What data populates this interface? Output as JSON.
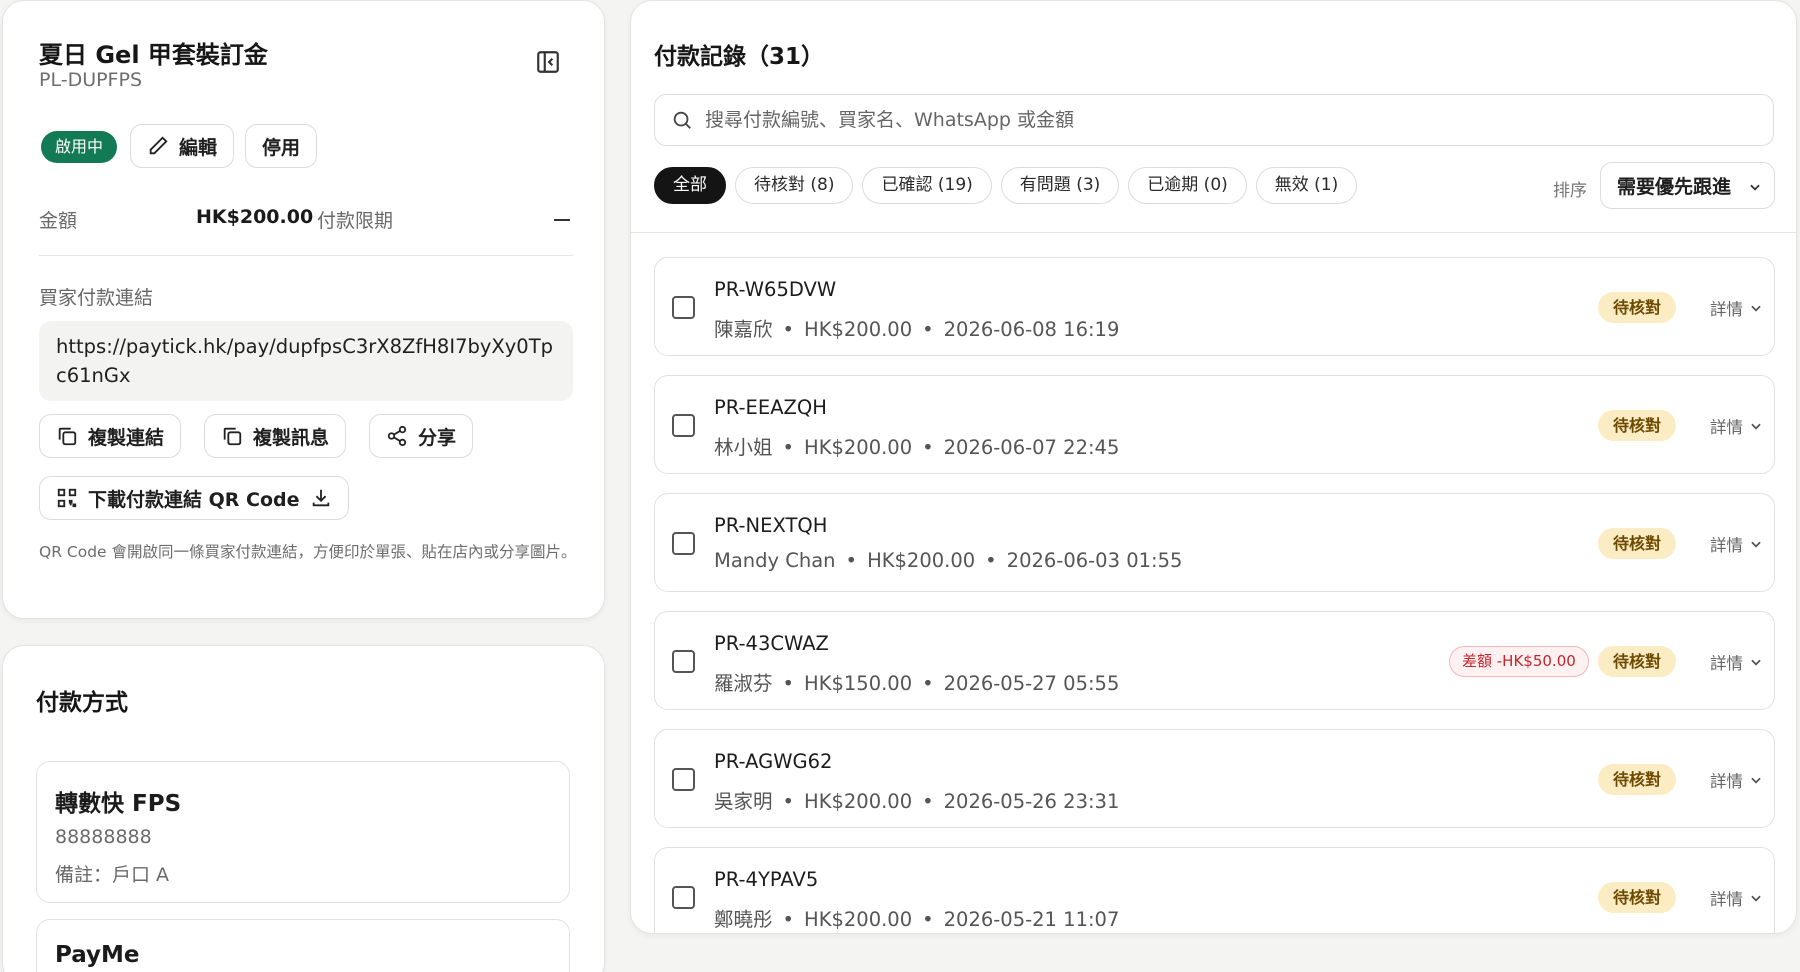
{
  "link_page": {
    "title": "夏日 Gel 甲套裝訂金",
    "code": "PL-DUPFPS",
    "status": "啟用中",
    "edit_label": "編輯",
    "disable_label": "停用",
    "amount_label": "金額",
    "amount_value": "HK$200.00",
    "deadline_label": "付款限期",
    "buyer_link_label": "買家付款連結",
    "buyer_link_url": "https://paytick.hk/pay/dupfpsC3rX8ZfH8I7byXy0Tpc61nGx",
    "copy_link_label": "複製連結",
    "copy_message_label": "複製訊息",
    "share_label": "分享",
    "qr_download_label": "下載付款連結 QR Code",
    "qr_hint": "QR Code 會開啟同一條買家付款連結，方便印於單張、貼在店內或分享圖片。"
  },
  "payment_methods": {
    "title": "付款方式",
    "items": [
      {
        "name": "轉數快 FPS",
        "account": "88888888",
        "note": "備註：戶口 A"
      },
      {
        "name": "PayMe"
      }
    ]
  },
  "records": {
    "title": "付款記錄（31）",
    "search_placeholder": "搜尋付款編號、買家名、WhatsApp 或金額",
    "filters": [
      {
        "label": "全部",
        "active": true
      },
      {
        "label": "待核對 (8)",
        "active": false
      },
      {
        "label": "已確認 (19)",
        "active": false
      },
      {
        "label": "有問題 (3)",
        "active": false
      },
      {
        "label": "已逾期 (0)",
        "active": false
      },
      {
        "label": "無效 (1)",
        "active": false
      }
    ],
    "sort_label": "排序",
    "sort_value": "需要優先跟進",
    "detail_label": "詳情",
    "items": [
      {
        "id": "PR-W65DVW",
        "buyer": "陳嘉欣",
        "amount": "HK$200.00",
        "time": "2026-06-08 16:19",
        "status": "待核對",
        "diff": ""
      },
      {
        "id": "PR-EEAZQH",
        "buyer": "林小姐",
        "amount": "HK$200.00",
        "time": "2026-06-07 22:45",
        "status": "待核對",
        "diff": ""
      },
      {
        "id": "PR-NEXTQH",
        "buyer": "Mandy Chan",
        "amount": "HK$200.00",
        "time": "2026-06-03 01:55",
        "status": "待核對",
        "diff": ""
      },
      {
        "id": "PR-43CWAZ",
        "buyer": "羅淑芬",
        "amount": "HK$150.00",
        "time": "2026-05-27 05:55",
        "status": "待核對",
        "diff": "差額 -HK$50.00"
      },
      {
        "id": "PR-AGWG62",
        "buyer": "吳家明",
        "amount": "HK$200.00",
        "time": "2026-05-26 23:31",
        "status": "待核對",
        "diff": ""
      },
      {
        "id": "PR-4YPAV5",
        "buyer": "鄭曉彤",
        "amount": "HK$200.00",
        "time": "2026-05-21 11:07",
        "status": "待核對",
        "diff": ""
      }
    ]
  },
  "colors": {
    "active_green": "#127a55",
    "pending_bg": "#fbecc4",
    "diff_red": "#c0262d"
  }
}
